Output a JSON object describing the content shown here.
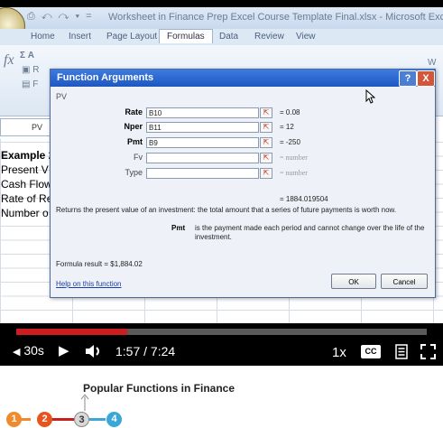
{
  "excel": {
    "window_title": "Worksheet in Finance Prep Excel Course Template Final.xlsx - Microsoft Excel",
    "tabs": [
      "Home",
      "Insert",
      "Page Layout",
      "Formulas",
      "Data",
      "Review",
      "View"
    ],
    "active_tab": "Formulas",
    "name_box": "PV",
    "cells": [
      "Example 2",
      "Present V",
      "Cash Flow",
      "Rate of Re",
      "Number o"
    ]
  },
  "dialog": {
    "title": "Function Arguments",
    "help_symbol": "?",
    "close_symbol": "X",
    "function_name": "PV",
    "args": [
      {
        "label": "Rate",
        "value": "B10",
        "result": "= 0.08",
        "required": true
      },
      {
        "label": "Nper",
        "value": "B11",
        "result": "= 12",
        "required": true
      },
      {
        "label": "Pmt",
        "value": "B9",
        "result": "= -250",
        "required": true
      },
      {
        "label": "Fv",
        "value": "",
        "result": "= number",
        "required": false
      },
      {
        "label": "Type",
        "value": "",
        "result": "= number",
        "required": false
      }
    ],
    "function_result": "= 1884.019504",
    "description": "Returns the present value of an investment: the total amount that a series of future payments is worth now.",
    "arg_desc_name": "Pmt",
    "arg_desc": "is the payment made each period and cannot change over the life of the investment.",
    "formula_result": "Formula result =  $1,884.02",
    "help_link": "Help on this function",
    "ok_label": "OK",
    "cancel_label": "Cancel"
  },
  "player": {
    "rewind_label": "30s",
    "time": "1:57 / 7:24",
    "speed": "1x",
    "cc_label": "CC",
    "progress": 0.27,
    "accent": "#cc1e1e"
  },
  "course": {
    "section_title": "Popular Functions in Finance",
    "steps": [
      "1",
      "2",
      "3",
      "4"
    ],
    "current_step": 3
  }
}
